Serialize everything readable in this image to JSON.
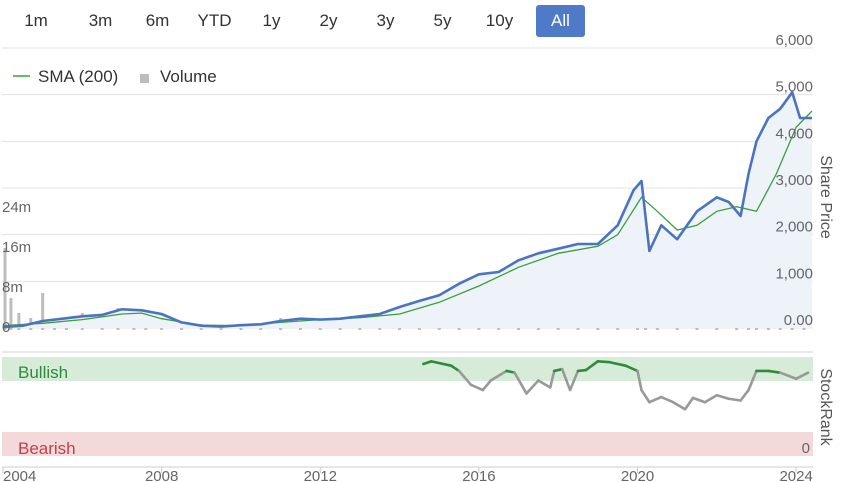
{
  "range_selector": {
    "buttons": [
      {
        "label": "1m",
        "active": false
      },
      {
        "label": "3m",
        "active": false
      },
      {
        "label": "6m",
        "active": false
      },
      {
        "label": "YTD",
        "active": false
      },
      {
        "label": "1y",
        "active": false
      },
      {
        "label": "2y",
        "active": false
      },
      {
        "label": "3y",
        "active": false
      },
      {
        "label": "5y",
        "active": false
      },
      {
        "label": "10y",
        "active": false
      },
      {
        "label": "All",
        "active": true
      }
    ],
    "active_color": "#4e7ac7"
  },
  "chart_data": [
    {
      "type": "line",
      "legend": {
        "items": [
          "SMA (200)",
          "Volume"
        ],
        "placement": "top-left"
      },
      "y_axis_right": {
        "title": "Share Price",
        "ticks": [
          "0.00",
          "1,000",
          "2,000",
          "3,000",
          "4,000",
          "5,000",
          "6,000"
        ],
        "range": [
          0,
          6000
        ]
      },
      "y_axis_left": {
        "title": "",
        "ticks": [
          "0",
          "8m",
          "16m",
          "24m"
        ],
        "range": [
          0,
          24
        ]
      },
      "grid": true,
      "series": [
        {
          "name": "",
          "color": "#4a74c0",
          "x": [
            2004.0,
            2004.5,
            2005.0,
            2005.5,
            2006.0,
            2006.5,
            2007.0,
            2007.5,
            2008.0,
            2008.5,
            2009.0,
            2009.5,
            2010.0,
            2010.5,
            2011.0,
            2011.5,
            2012.0,
            2012.5,
            2013.0,
            2013.5,
            2014.0,
            2014.5,
            2015.0,
            2015.5,
            2016.0,
            2016.5,
            2017.0,
            2017.5,
            2018.0,
            2018.5,
            2019.0,
            2019.5,
            2019.9,
            2020.1,
            2020.3,
            2020.6,
            2021.0,
            2021.5,
            2022.0,
            2022.3,
            2022.6,
            2022.8,
            2023.0,
            2023.3,
            2023.6,
            2023.9,
            2024.1,
            2024.4
          ],
          "y": [
            20,
            50,
            150,
            200,
            250,
            280,
            400,
            380,
            300,
            120,
            50,
            30,
            60,
            80,
            150,
            200,
            180,
            200,
            250,
            300,
            450,
            580,
            700,
            950,
            1150,
            1200,
            1450,
            1600,
            1700,
            1800,
            1800,
            2200,
            2950,
            3150,
            1650,
            2200,
            1900,
            2500,
            2800,
            2700,
            2400,
            3300,
            4000,
            4500,
            4700,
            5050,
            4500,
            4500
          ]
        },
        {
          "name": "SMA (200)",
          "color": "#3aa03a",
          "x": [
            2004.0,
            2005.0,
            2006.0,
            2007.0,
            2007.5,
            2008.0,
            2009.0,
            2010.0,
            2011.0,
            2012.0,
            2013.0,
            2014.0,
            2015.0,
            2016.0,
            2017.0,
            2018.0,
            2019.0,
            2019.5,
            2020.1,
            2020.5,
            2021.0,
            2021.5,
            2022.0,
            2022.5,
            2023.0,
            2023.5,
            2024.0,
            2024.4
          ],
          "y": [
            50,
            100,
            180,
            300,
            320,
            200,
            60,
            50,
            120,
            180,
            220,
            300,
            550,
            900,
            1300,
            1600,
            1750,
            2000,
            2800,
            2500,
            2100,
            2200,
            2500,
            2600,
            2500,
            3300,
            4300,
            4650
          ]
        },
        {
          "name": "Volume",
          "color": "#bdbdbd",
          "type": "bar",
          "x": [
            2004.05,
            2004.2,
            2004.4,
            2004.7,
            2005.0,
            2005.3,
            2005.6,
            2006.0,
            2006.5,
            2006.9,
            2007.3,
            2007.6,
            2008.0,
            2008.5,
            2009.0,
            2009.5,
            2010.0,
            2010.5,
            2011.0,
            2011.5,
            2012.0,
            2012.5,
            2013.0,
            2013.5,
            2014.0,
            2014.5,
            2015.0,
            2015.5,
            2016.0,
            2016.5,
            2017.0,
            2017.5,
            2018.0,
            2018.5,
            2019.0,
            2019.5,
            2020.0,
            2020.2,
            2020.5,
            2021.0,
            2021.5,
            2022.0,
            2022.5,
            2022.8,
            2023.0,
            2023.3,
            2023.6,
            2023.9,
            2024.2
          ],
          "values": [
            16,
            6,
            3,
            2,
            7,
            1.5,
            2,
            3,
            1,
            4,
            2,
            1.5,
            1.2,
            1,
            0.8,
            0.5,
            0.7,
            0.8,
            2,
            1,
            1.2,
            0.8,
            0.7,
            1,
            2,
            1.5,
            1,
            0.8,
            1,
            0.7,
            0.8,
            0.6,
            0.7,
            1,
            0.8,
            1,
            2.5,
            3,
            1.5,
            1.2,
            1,
            1.5,
            1,
            1.3,
            1.5,
            1.8,
            2,
            6.5,
            4
          ]
        }
      ]
    },
    {
      "type": "line",
      "y_axis_right": {
        "title": "StockRank",
        "ticks": [
          "0"
        ],
        "range": [
          0,
          100
        ]
      },
      "zones": [
        {
          "label": "Bullish",
          "color": "#d7ecd8",
          "text_color": "#2e8b3a"
        },
        {
          "label": "Bearish",
          "color": "#f4d9da",
          "text_color": "#c0404a"
        }
      ],
      "series": [
        {
          "name": "",
          "x": [
            2014.6,
            2014.8,
            2015.3,
            2015.5,
            2015.8,
            2016.1,
            2016.3,
            2016.7,
            2016.9,
            2017.2,
            2017.5,
            2017.8,
            2017.9,
            2018.1,
            2018.3,
            2018.5,
            2018.7,
            2019.0,
            2019.3,
            2019.7,
            2020.0,
            2020.1,
            2020.3,
            2020.6,
            2020.9,
            2021.2,
            2021.4,
            2021.7,
            2022.0,
            2022.3,
            2022.6,
            2022.8,
            2023.0,
            2023.3,
            2023.6,
            2024.0,
            2024.3
          ],
          "y": [
            92,
            95,
            90,
            84,
            68,
            62,
            73,
            84,
            82,
            58,
            73,
            65,
            84,
            86,
            62,
            84,
            85,
            95,
            94,
            90,
            84,
            62,
            48,
            54,
            48,
            40,
            53,
            48,
            56,
            52,
            50,
            62,
            84,
            84,
            82,
            75,
            82
          ],
          "bullish_threshold": 80,
          "colors": {
            "above": "#2e8b3a",
            "below": "#999999"
          }
        }
      ]
    }
  ],
  "x_axis": {
    "ticks": [
      "2004",
      "2008",
      "2012",
      "2016",
      "2020",
      "2024"
    ]
  }
}
